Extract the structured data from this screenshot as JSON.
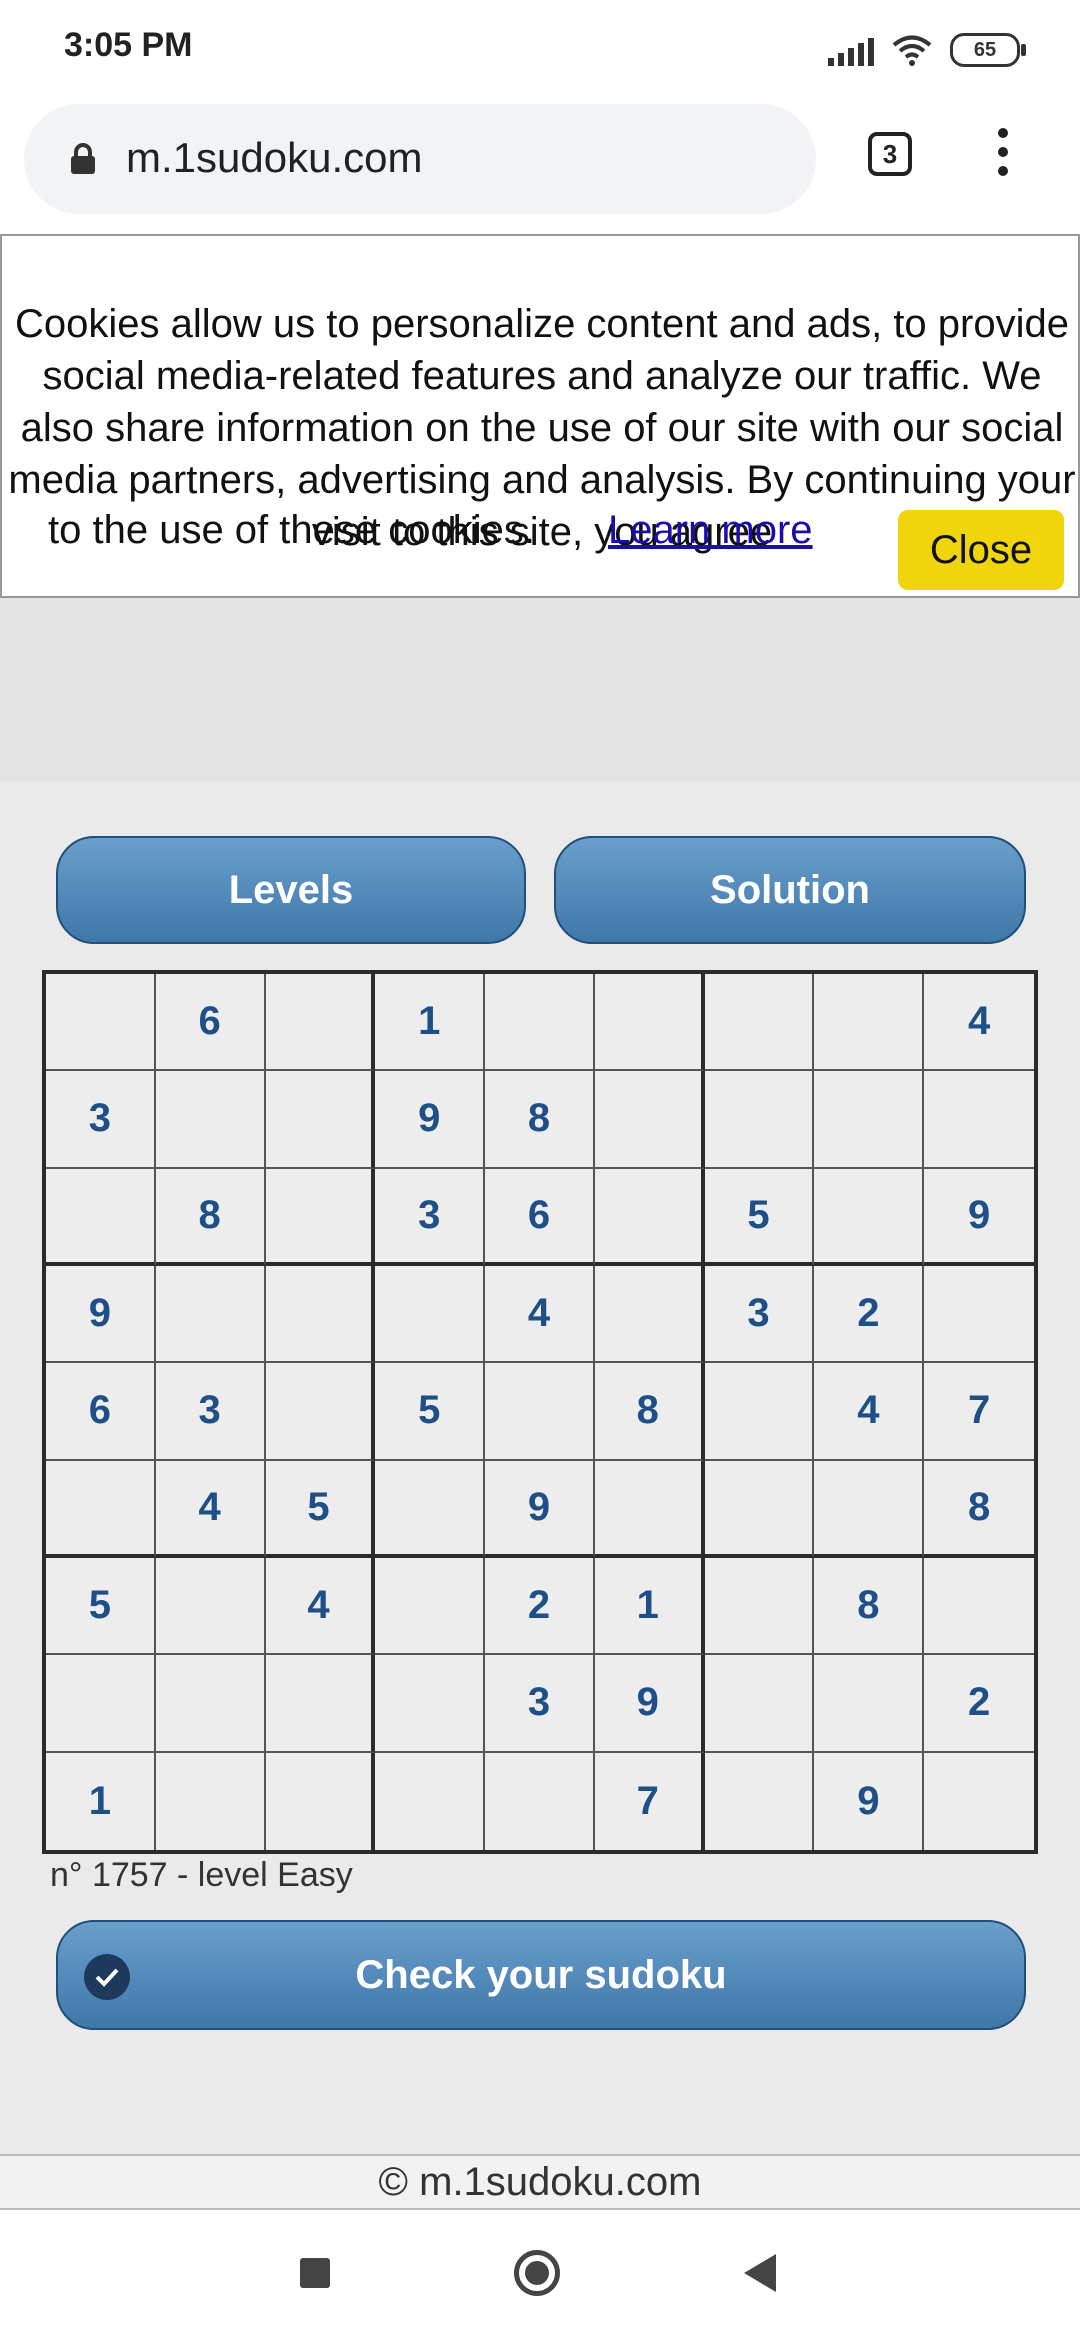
{
  "status_bar": {
    "time": "3:05 PM",
    "battery": "65",
    "icons": [
      "signal-icon",
      "wifi-icon",
      "battery-icon"
    ]
  },
  "browser": {
    "url": "m.1sudoku.com",
    "tab_count": "3",
    "icons": [
      "lock-icon",
      "tabs-icon",
      "more-vert-icon"
    ]
  },
  "cookie_banner": {
    "text": "Cookies allow us to personalize content and ads, to provide social media-related features and analyze our traffic. We also share information on the use of our site with our social media partners, advertising and analysis. By continuing your visit to this site, you agree",
    "text_end": "to the use of these cookies.",
    "learn_more": "Learn more",
    "close": "Close",
    "close_color": "#f0d40c"
  },
  "buttons": {
    "levels": "Levels",
    "solution": "Solution",
    "check": "Check your sudoku",
    "accent": "#4a82b5"
  },
  "puzzle": {
    "info": "n° 1757 - level Easy",
    "grid": [
      [
        "",
        "6",
        "",
        "1",
        "",
        "",
        "",
        "",
        "4"
      ],
      [
        "3",
        "",
        "",
        "9",
        "8",
        "",
        "",
        "",
        ""
      ],
      [
        "",
        "8",
        "",
        "3",
        "6",
        "",
        "5",
        "",
        "9"
      ],
      [
        "9",
        "",
        "",
        "",
        "4",
        "",
        "3",
        "2",
        ""
      ],
      [
        "6",
        "3",
        "",
        "5",
        "",
        "8",
        "",
        "4",
        "7"
      ],
      [
        "",
        "4",
        "5",
        "",
        "9",
        "",
        "",
        "",
        "8"
      ],
      [
        "5",
        "",
        "4",
        "",
        "2",
        "1",
        "",
        "8",
        ""
      ],
      [
        "",
        "",
        "",
        "",
        "3",
        "9",
        "",
        "",
        "2"
      ],
      [
        "1",
        "",
        "",
        "",
        "",
        "7",
        "",
        "9",
        ""
      ]
    ]
  },
  "footer": {
    "text": "© m.1sudoku.com"
  },
  "nav_bar": {
    "icons": [
      "recents-square-icon",
      "home-circle-icon",
      "back-triangle-icon"
    ]
  }
}
